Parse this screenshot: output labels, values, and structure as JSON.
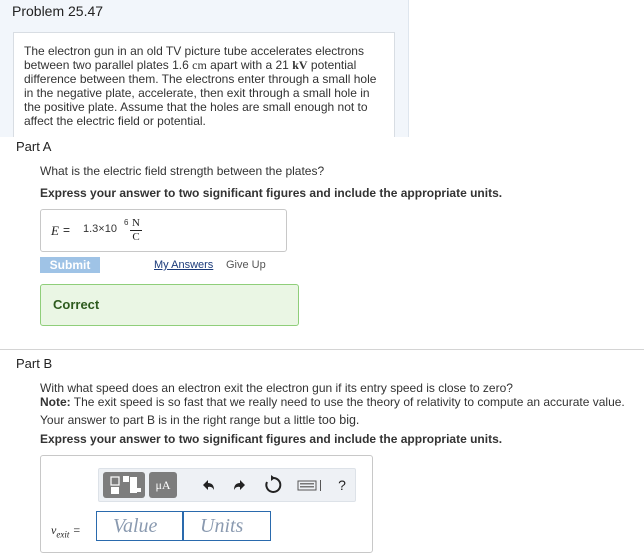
{
  "problem": {
    "title": "Problem 25.47",
    "text_part1": "The electron gun in an old TV picture tube accelerates electrons between two parallel plates 1.6",
    "unit_cm": "cm",
    "text_part2": "apart with a 21",
    "unit_kV": "kV",
    "text_part3": "potential difference between them. The electrons enter through a small hole in the negative plate, accelerate, then exit through a small hole in the positive plate. Assume that the holes are small enough not to affect the electric field or potential."
  },
  "partA": {
    "label": "Part A",
    "question": "What is the electric field strength between the plates?",
    "instruction": "Express your answer to two significant figures and include the appropriate units.",
    "answer_var": "E",
    "answer_eq": "=",
    "answer_value": "1.3×10",
    "answer_exp": "6",
    "answer_unit_num": "N",
    "answer_unit_den": "C",
    "submit_label": "Submit",
    "my_answers_label": "My Answers",
    "give_up_label": "Give Up",
    "feedback": "Correct"
  },
  "partB": {
    "label": "Part B",
    "question": "With what speed does an electron exit the electron gun if its entry speed is close to zero?",
    "note_label": "Note:",
    "note_text": "The exit speed is so fast that we really need to use the theory of relativity to compute an accurate value.",
    "hint_a": "Your answer to part B is in the right range but a little",
    "hint_b": "too big.",
    "instruction": "Express your answer to two significant figures and include the appropriate units.",
    "var": "v",
    "var_sub": "exit",
    "eq": "=",
    "value_placeholder": "Value",
    "units_placeholder": "Units",
    "mu_label": "μA",
    "help_label": "?"
  },
  "colors": {
    "correct_bg": "#eaf6e4",
    "correct_border": "#8fce7a",
    "submit_bg": "#9fc3e6",
    "field_border": "#2a6aad"
  },
  "icons": [
    "templates-icon",
    "units-icon",
    "undo-icon",
    "redo-icon",
    "reset-icon",
    "keyboard-icon",
    "help-icon"
  ]
}
